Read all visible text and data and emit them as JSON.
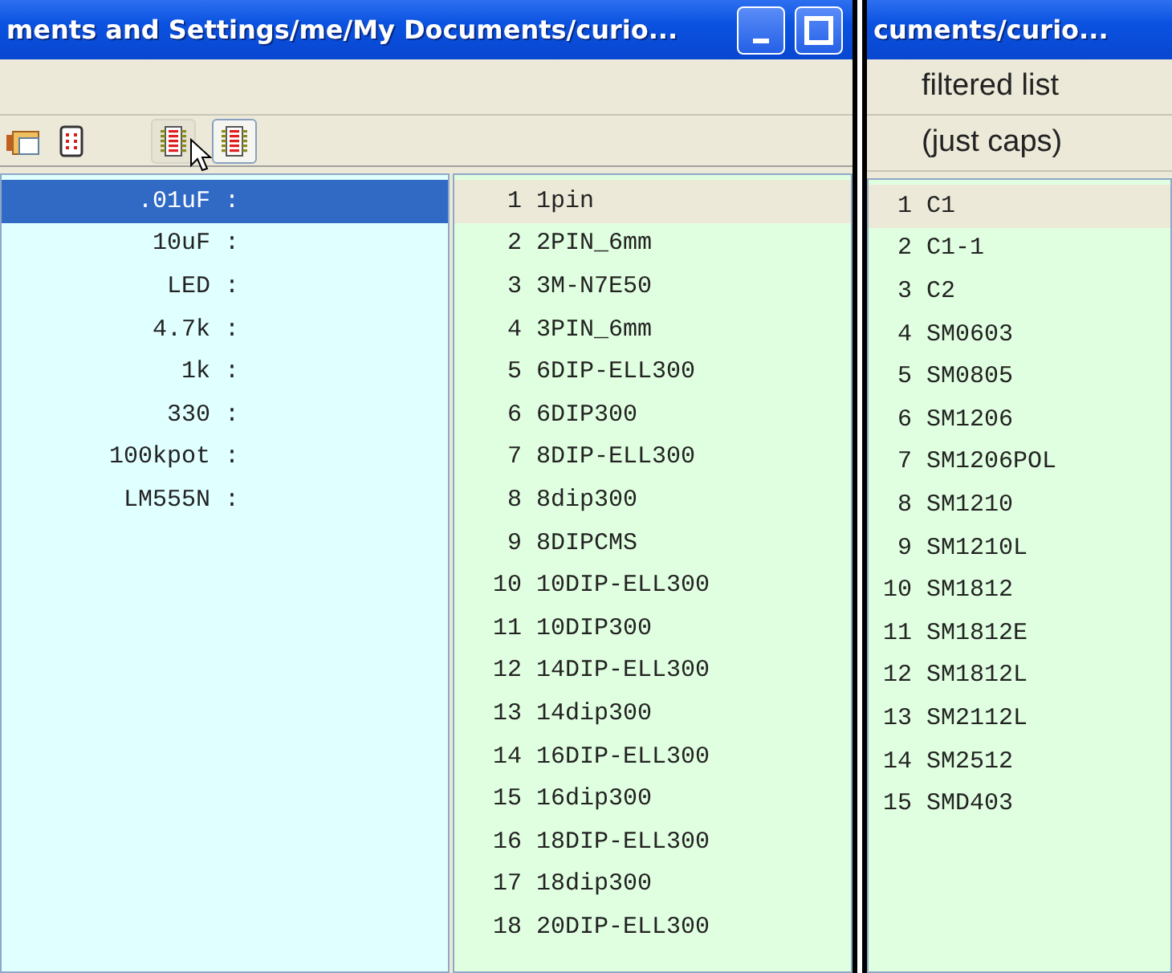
{
  "left_window": {
    "title": "ments and Settings/me/My Documents/curio...",
    "parts_list": [
      {
        "label": ".01uF",
        "selected": true
      },
      {
        "label": "10uF",
        "selected": false
      },
      {
        "label": "LED",
        "selected": false
      },
      {
        "label": "4.7k",
        "selected": false
      },
      {
        "label": "1k",
        "selected": false
      },
      {
        "label": "330",
        "selected": false
      },
      {
        "label": "100kpot",
        "selected": false
      },
      {
        "label": "LM555N",
        "selected": false
      }
    ],
    "separator": ":",
    "footprints": [
      {
        "number": "1",
        "name": "1pin",
        "selected": true
      },
      {
        "number": "2",
        "name": "2PIN_6mm",
        "selected": false
      },
      {
        "number": "3",
        "name": "3M-N7E50",
        "selected": false
      },
      {
        "number": "4",
        "name": "3PIN_6mm",
        "selected": false
      },
      {
        "number": "5",
        "name": "6DIP-ELL300",
        "selected": false
      },
      {
        "number": "6",
        "name": "6DIP300",
        "selected": false
      },
      {
        "number": "7",
        "name": "8DIP-ELL300",
        "selected": false
      },
      {
        "number": "8",
        "name": "8dip300",
        "selected": false
      },
      {
        "number": "9",
        "name": "8DIPCMS",
        "selected": false
      },
      {
        "number": "10",
        "name": "10DIP-ELL300",
        "selected": false
      },
      {
        "number": "11",
        "name": "10DIP300",
        "selected": false
      },
      {
        "number": "12",
        "name": "14DIP-ELL300",
        "selected": false
      },
      {
        "number": "13",
        "name": "14dip300",
        "selected": false
      },
      {
        "number": "14",
        "name": "16DIP-ELL300",
        "selected": false
      },
      {
        "number": "15",
        "name": "16dip300",
        "selected": false
      },
      {
        "number": "16",
        "name": "18DIP-ELL300",
        "selected": false
      },
      {
        "number": "17",
        "name": "18dip300",
        "selected": false
      },
      {
        "number": "18",
        "name": "20DIP-ELL300",
        "selected": false
      }
    ]
  },
  "right_window": {
    "title": "cuments/curio...",
    "header": [
      "filtered list",
      "(just caps)"
    ],
    "filtered": [
      {
        "number": "1",
        "name": "C1",
        "selected": true
      },
      {
        "number": "2",
        "name": "C1-1",
        "selected": false
      },
      {
        "number": "3",
        "name": "C2",
        "selected": false
      },
      {
        "number": "4",
        "name": "SM0603",
        "selected": false
      },
      {
        "number": "5",
        "name": "SM0805",
        "selected": false
      },
      {
        "number": "6",
        "name": "SM1206",
        "selected": false
      },
      {
        "number": "7",
        "name": "SM1206POL",
        "selected": false
      },
      {
        "number": "8",
        "name": "SM1210",
        "selected": false
      },
      {
        "number": "9",
        "name": "SM1210L",
        "selected": false
      },
      {
        "number": "10",
        "name": "SM1812",
        "selected": false
      },
      {
        "number": "11",
        "name": "SM1812E",
        "selected": false
      },
      {
        "number": "12",
        "name": "SM1812L",
        "selected": false
      },
      {
        "number": "13",
        "name": "SM2112L",
        "selected": false
      },
      {
        "number": "14",
        "name": "SM2512",
        "selected": false
      },
      {
        "number": "15",
        "name": "SMD403",
        "selected": false
      }
    ]
  }
}
